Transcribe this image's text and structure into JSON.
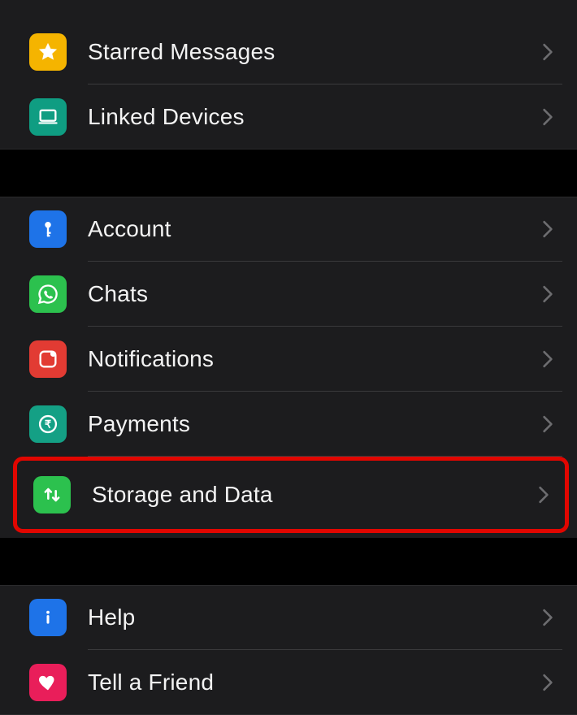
{
  "colors": {
    "chevron": "#6d6d70",
    "highlight": "#e10600"
  },
  "groups": [
    {
      "items": [
        {
          "key": "starred",
          "label": "Starred Messages",
          "icon": "star-icon",
          "iconBg": "#f5b400"
        },
        {
          "key": "devices",
          "label": "Linked Devices",
          "icon": "laptop-icon",
          "iconBg": "#0f9d82"
        }
      ]
    },
    {
      "items": [
        {
          "key": "account",
          "label": "Account",
          "icon": "key-icon",
          "iconBg": "#1e73e8"
        },
        {
          "key": "chats",
          "label": "Chats",
          "icon": "whatsapp-icon",
          "iconBg": "#2cc14e"
        },
        {
          "key": "notifications",
          "label": "Notifications",
          "icon": "bell-icon",
          "iconBg": "#e23b33"
        },
        {
          "key": "payments",
          "label": "Payments",
          "icon": "rupee-icon",
          "iconBg": "#14a085"
        },
        {
          "key": "storage",
          "label": "Storage and Data",
          "icon": "data-icon",
          "iconBg": "#2cc14e",
          "highlighted": true
        }
      ]
    },
    {
      "items": [
        {
          "key": "help",
          "label": "Help",
          "icon": "info-icon",
          "iconBg": "#1e73e8"
        },
        {
          "key": "tell",
          "label": "Tell a Friend",
          "icon": "heart-icon",
          "iconBg": "#e91e5a"
        }
      ]
    }
  ]
}
